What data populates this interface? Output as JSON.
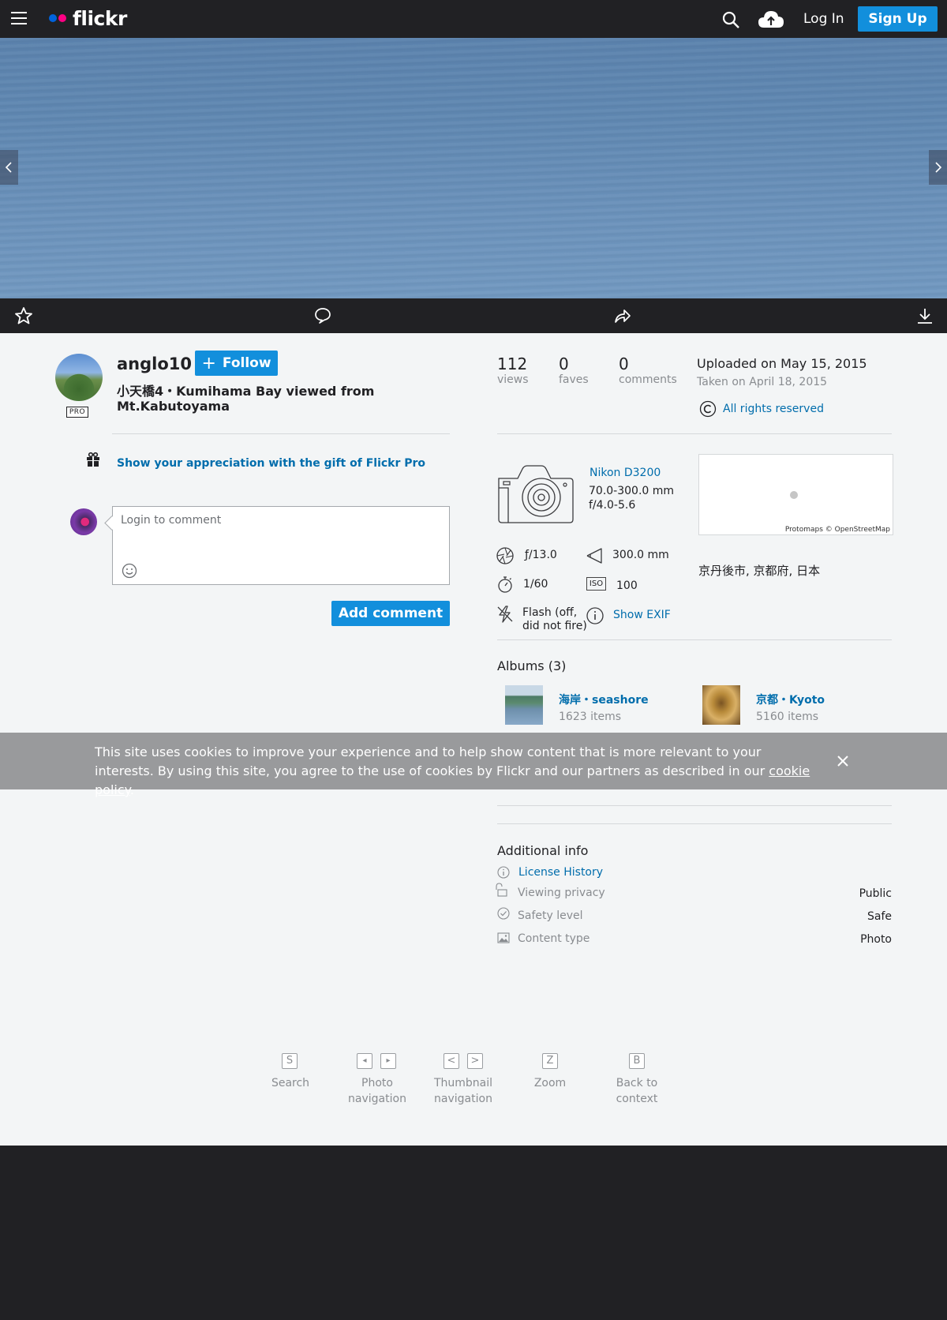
{
  "header": {
    "logo_text": "flickr",
    "logo_colors": [
      "#0063dc",
      "#ff0084"
    ],
    "login_label": "Log In",
    "signup_label": "Sign Up"
  },
  "owner": {
    "name": "anglo10",
    "badge": "PRO",
    "follow_label": "Follow",
    "photo_title": "小天橋4・Kumihama Bay viewed from Mt.Kabutoyama"
  },
  "gift": {
    "text": "Show your appreciation with the gift of Flickr Pro"
  },
  "comment": {
    "placeholder": "Login to comment",
    "button_label": "Add comment"
  },
  "stats": {
    "views": {
      "value": "112",
      "label": "views"
    },
    "faves": {
      "value": "0",
      "label": "faves"
    },
    "comments": {
      "value": "0",
      "label": "comments"
    },
    "uploaded": "Uploaded on May 15, 2015",
    "taken": "Taken on April 18, 2015",
    "license": "All rights reserved"
  },
  "camera": {
    "model": "Nikon D3200",
    "lens": "70.0-300.0 mm",
    "aperture_range": "f/4.0-5.6"
  },
  "exif": {
    "fnumber": "ƒ/13.0",
    "focal_length": "300.0 mm",
    "shutter": "1/60",
    "iso_icon": "ISO",
    "iso": "100",
    "flash": "Flash (off, did not fire)",
    "show_exif": "Show EXIF"
  },
  "map": {
    "credit": "Protomaps © OpenStreetMap",
    "location": "京丹後市, 京都府, 日本"
  },
  "albums": {
    "heading": "Albums (3)",
    "items": [
      {
        "title": "海岸・seashore",
        "count": "1623 items"
      },
      {
        "title": "京都・Kyoto",
        "count": "5160 items"
      }
    ]
  },
  "cookie": {
    "text": "This site uses cookies to improve your experience and to help show content that is more relevant to your interests. By using this site, you agree to the use of cookies by Flickr and our partners as described in our ",
    "link": "cookie policy",
    "suffix": "."
  },
  "additional_info": {
    "heading": "Additional info",
    "license_history": "License History",
    "privacy": {
      "label": "Viewing privacy",
      "value": "Public"
    },
    "safety": {
      "label": "Safety level",
      "value": "Safe"
    },
    "content": {
      "label": "Content type",
      "value": "Photo"
    }
  },
  "shortcuts": [
    {
      "keys": [
        "S"
      ],
      "label": "Search"
    },
    {
      "keys": [
        "◂",
        "▸"
      ],
      "label": "Photo navigation"
    },
    {
      "keys": [
        "<",
        ">"
      ],
      "label": "Thumbnail navigation"
    },
    {
      "keys": [
        "Z"
      ],
      "label": "Zoom"
    },
    {
      "keys": [
        "B"
      ],
      "label": "Back to context"
    }
  ],
  "colors": {
    "accent": "#128fdc",
    "link": "#006dac",
    "dark": "#212124"
  }
}
